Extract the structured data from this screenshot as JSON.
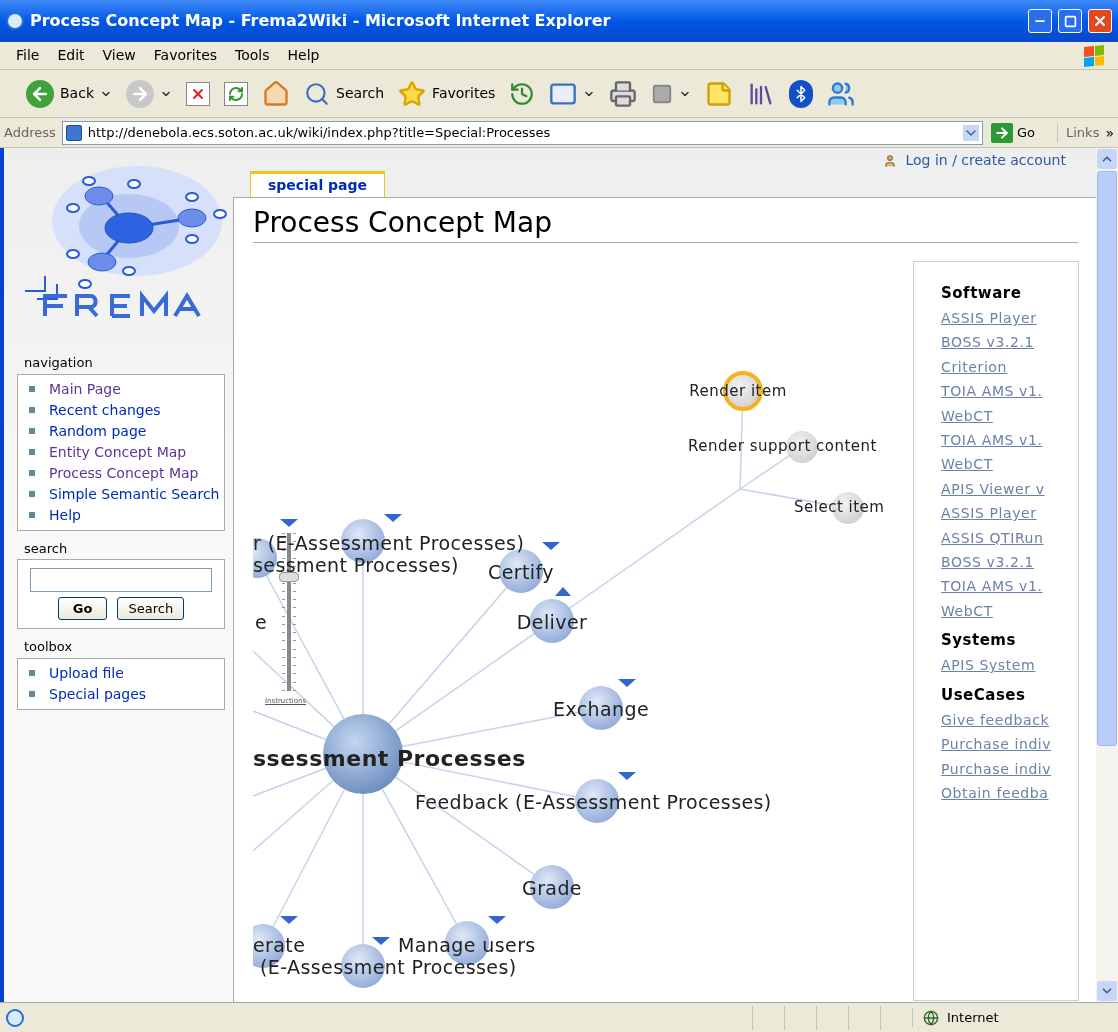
{
  "window": {
    "title": "Process Concept Map - Frema2Wiki - Microsoft Internet Explorer"
  },
  "menu_bar": [
    "File",
    "Edit",
    "View",
    "Favorites",
    "Tools",
    "Help"
  ],
  "toolbar": [
    {
      "kind": "back",
      "label": "Back",
      "dropdown": true
    },
    {
      "kind": "forward",
      "dropdown": true
    },
    {
      "kind": "stop",
      "dropdown": false
    },
    {
      "kind": "refresh",
      "dropdown": false
    },
    {
      "kind": "home",
      "dropdown": false
    },
    {
      "kind": "search",
      "label": "Search",
      "dropdown": false
    },
    {
      "kind": "favorites",
      "label": "Favorites",
      "dropdown": false
    },
    {
      "kind": "history",
      "dropdown": false
    },
    {
      "kind": "mail",
      "dropdown": true
    },
    {
      "kind": "print",
      "dropdown": false
    },
    {
      "kind": "edit",
      "dropdown": true
    },
    {
      "kind": "note",
      "dropdown": false
    },
    {
      "kind": "research",
      "dropdown": false
    },
    {
      "kind": "bluetooth",
      "dropdown": false
    },
    {
      "kind": "messenger",
      "dropdown": false
    }
  ],
  "address_bar": {
    "label": "Address",
    "url": "http://denebola.ecs.soton.ac.uk/wiki/index.php?title=Special:Processes",
    "go": "Go",
    "links": "Links",
    "more": "»"
  },
  "personal": {
    "login": "Log in / create account"
  },
  "tabs": [
    {
      "label": "special page",
      "selected": true
    }
  ],
  "sidebar": {
    "navigation": {
      "heading": "navigation",
      "items": [
        {
          "label": "Main Page",
          "visited": true
        },
        {
          "label": "Recent changes",
          "visited": false
        },
        {
          "label": "Random page",
          "visited": false
        },
        {
          "label": "Entity Concept Map",
          "visited": true
        },
        {
          "label": "Process Concept Map",
          "visited": true
        },
        {
          "label": "Simple Semantic Search",
          "visited": false
        },
        {
          "label": "Help",
          "visited": false
        }
      ]
    },
    "search": {
      "heading": "search",
      "go": "Go",
      "search": "Search"
    },
    "toolbox": {
      "heading": "toolbox",
      "items": [
        {
          "label": "Upload file",
          "visited": false
        },
        {
          "label": "Special pages",
          "visited": false
        }
      ]
    }
  },
  "page_title": "Process Concept Map",
  "concept_map": {
    "slider": {
      "level": 0.72,
      "label": "Instructions"
    },
    "nodes": [
      {
        "label": "Render item",
        "kind": "task",
        "selected": true
      },
      {
        "label": "Render support content",
        "kind": "task",
        "selected": false
      },
      {
        "label": "Select item",
        "kind": "task",
        "selected": false
      },
      {
        "label": "r (E-Assessment Processes)",
        "kind": "process",
        "selected": false,
        "toggle": {
          "expanded": false
        }
      },
      {
        "label": "sessment Processes)",
        "kind": "process",
        "selected": false,
        "toggle": {
          "expanded": false
        }
      },
      {
        "label": "Certify",
        "kind": "process",
        "selected": false,
        "toggle": {
          "expanded": false
        }
      },
      {
        "label": "e",
        "kind": "process",
        "selected": false
      },
      {
        "label": "Deliver",
        "kind": "process",
        "selected": false,
        "toggle": {
          "expanded": true
        }
      },
      {
        "label": "Exchange",
        "kind": "process",
        "selected": false,
        "toggle": {
          "expanded": false
        }
      },
      {
        "label": "ssessment Processes",
        "kind": "root",
        "selected": false
      },
      {
        "label": "Feedback (E-Assessment Processes)",
        "kind": "process",
        "selected": false,
        "toggle": {
          "expanded": false
        }
      },
      {
        "label": "Grade",
        "kind": "process",
        "selected": false
      },
      {
        "label": "erate",
        "kind": "process",
        "selected": false,
        "toggle": {
          "expanded": false
        }
      },
      {
        "label": "Manage users",
        "kind": "process",
        "selected": false,
        "toggle": {
          "expanded": false
        }
      },
      {
        "label": "(E-Assessment Processes)",
        "kind": "process",
        "selected": false,
        "toggle": {
          "expanded": false
        }
      }
    ]
  },
  "related": {
    "sections": [
      {
        "heading": "Software",
        "links": [
          "ASSIS Player",
          "BOSS v3.2.1",
          "Criterion",
          "TOIA AMS v1.",
          "WebCT",
          "TOIA AMS v1.",
          "WebCT",
          "APIS Viewer v",
          "ASSIS Player",
          "ASSIS QTIRun",
          "BOSS v3.2.1",
          "TOIA AMS v1.",
          "WebCT"
        ]
      },
      {
        "heading": "Systems",
        "links": [
          "APIS System"
        ]
      },
      {
        "heading": "UseCases",
        "links": [
          "Give feedback",
          "Purchase indiv",
          "Purchase indiv",
          "Obtain feedba"
        ]
      }
    ]
  },
  "status_bar": {
    "zone": "Internet"
  }
}
